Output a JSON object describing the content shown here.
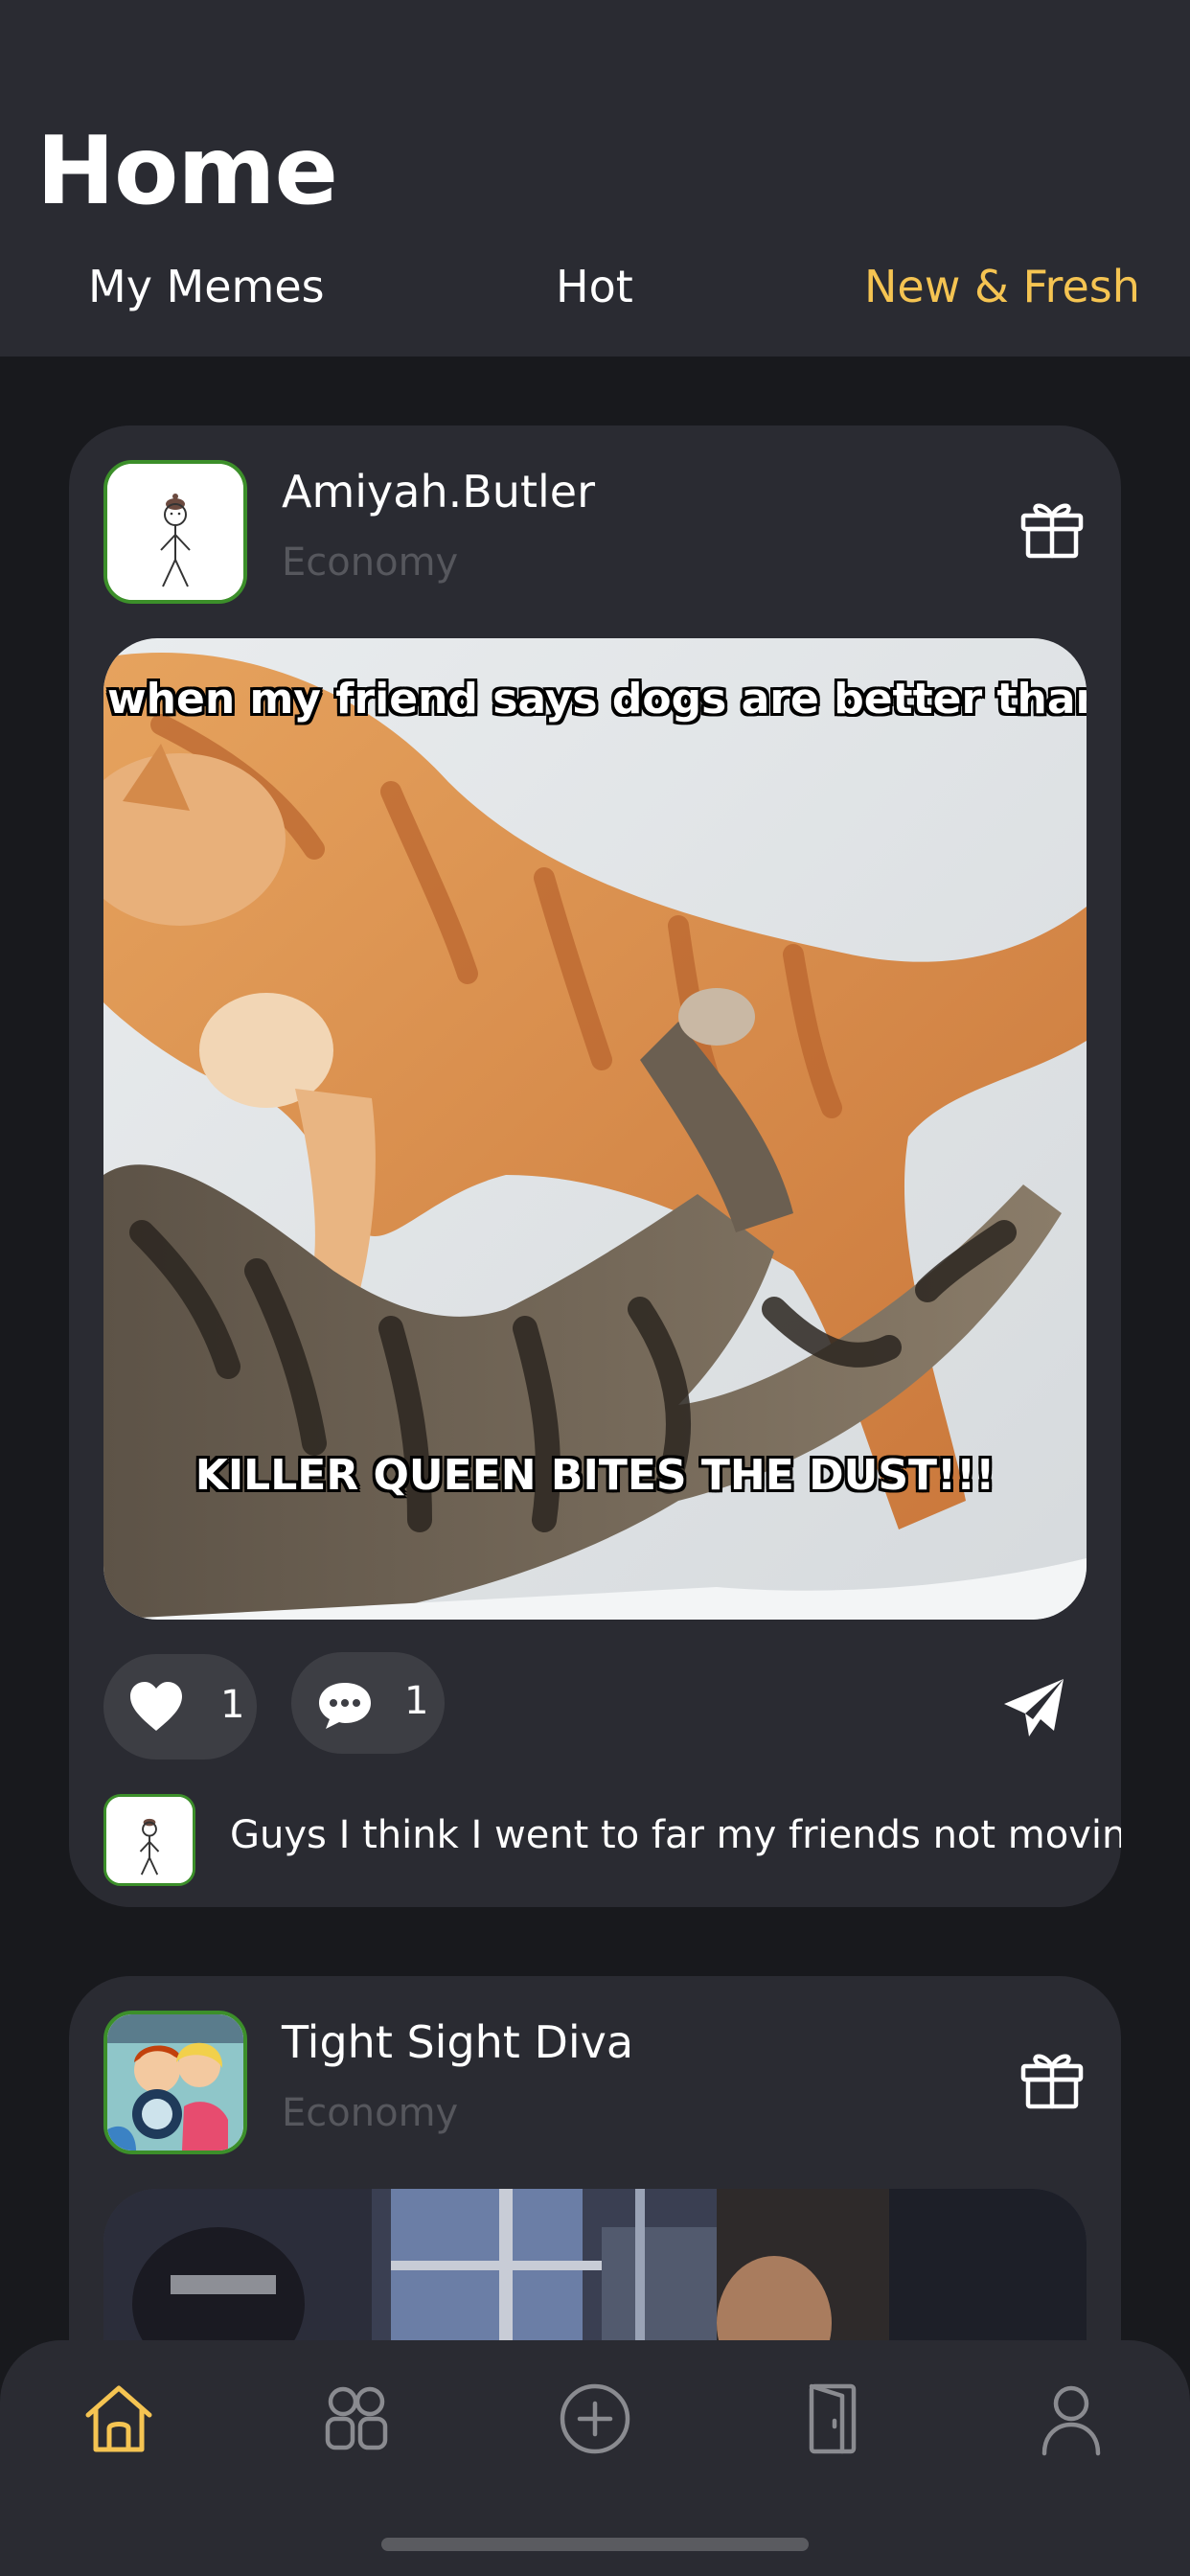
{
  "header": {
    "title": "Home",
    "tabs": [
      {
        "label": "My Memes",
        "active": false
      },
      {
        "label": "Hot",
        "active": false
      },
      {
        "label": "New & Fresh",
        "active": true
      }
    ]
  },
  "posts": [
    {
      "username": "Amiyah.Butler",
      "category": "Economy",
      "meme_top_text": "when my friend says dogs are better than c",
      "meme_bottom_text": "KILLER QUEEN BITES THE DUST!!!",
      "likes": "1",
      "comments": "1",
      "latest_comment": "Guys I think I went to far my friends not moving..."
    },
    {
      "username": "Tight Sight Diva",
      "category": "Economy"
    }
  ],
  "nav": {
    "items": [
      "home-icon",
      "memes-icon",
      "add-icon",
      "wallet-icon",
      "profile-icon"
    ],
    "active_color": "#f5c452",
    "inactive_color": "#8a8b90"
  },
  "colors": {
    "accent": "#f5c452",
    "background": "#18191d",
    "surface": "#2a2b32",
    "avatar_border": "#3c8f2a"
  }
}
